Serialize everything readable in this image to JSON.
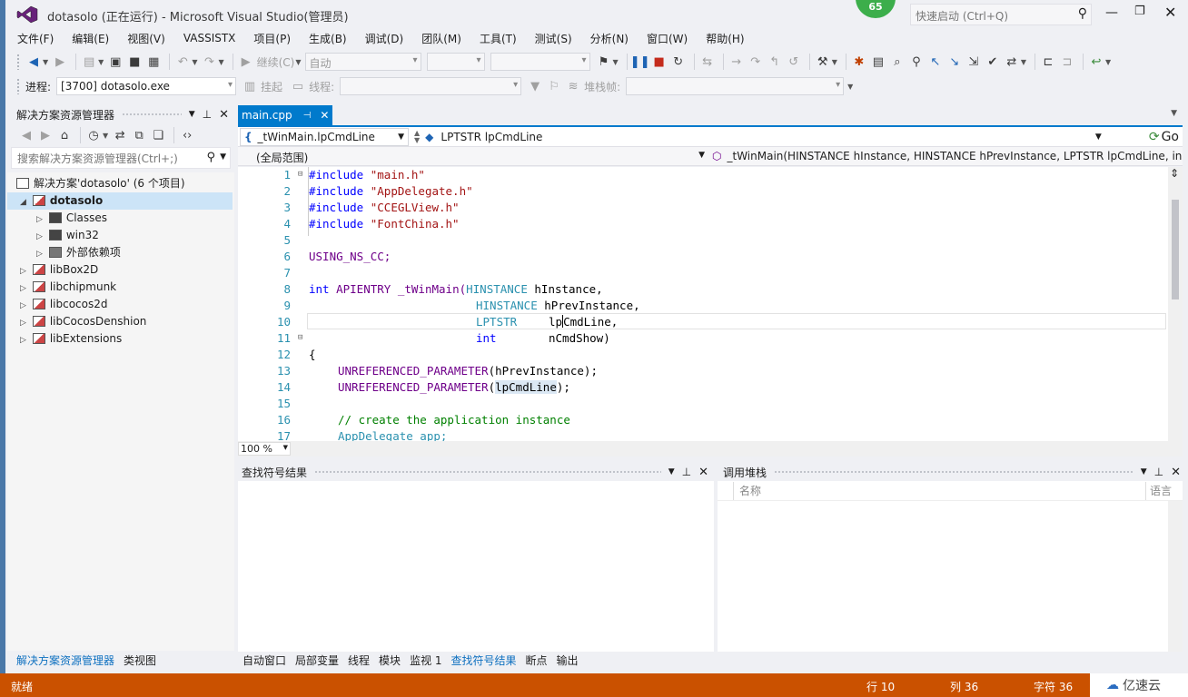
{
  "title": {
    "text": "dotasolo (正在运行) - Microsoft Visual Studio(管理员)",
    "badge": "65",
    "quick_launch": "快速启动 (Ctrl+Q)"
  },
  "menu": [
    "文件(F)",
    "编辑(E)",
    "视图(V)",
    "VASSISTX",
    "项目(P)",
    "生成(B)",
    "调试(D)",
    "团队(M)",
    "工具(T)",
    "测试(S)",
    "分析(N)",
    "窗口(W)",
    "帮助(H)"
  ],
  "toolbar": {
    "continue": "继续(C)",
    "config": "自动"
  },
  "debugbar": {
    "process_label": "进程:",
    "process_value": "[3700] dotasolo.exe",
    "suspend": "挂起",
    "thread": "线程:",
    "stackframe": "堆栈帧:"
  },
  "solution": {
    "title": "解决方案资源管理器",
    "search": "搜索解决方案资源管理器(Ctrl+;)",
    "root": "解决方案'dotasolo' (6 个项目)",
    "items": [
      "dotasolo",
      "Classes",
      "win32",
      "外部依赖项",
      "libBox2D",
      "libchipmunk",
      "libcocos2d",
      "libCocosDenshion",
      "libExtensions"
    ],
    "tab1": "解决方案资源管理器",
    "tab2": "类视图"
  },
  "editor": {
    "tab": "main.cpp",
    "nav_left": "_tWinMain.lpCmdLine",
    "nav_right": "LPTSTR lpCmdLine",
    "go": "Go",
    "scope": "(全局范围)",
    "func": "_tWinMain(HINSTANCE hInstance, HINSTANCE hPrevInstance, LPTSTR lpCmdLine, in",
    "zoom": "100 %",
    "lines": [
      "1",
      "2",
      "3",
      "4",
      "5",
      "6",
      "7",
      "8",
      "9",
      "10",
      "11",
      "12",
      "13",
      "14",
      "15",
      "16",
      "17"
    ],
    "code": {
      "inc": "#include",
      "h1": "\"main.h\"",
      "h2": "\"AppDelegate.h\"",
      "h3": "\"CCEGLView.h\"",
      "h4": "\"FontChina.h\"",
      "using": "USING_NS_CC;",
      "int": "int",
      "apientry": "APIENTRY",
      "fn": "_tWinMain(",
      "hinst": "HINSTANCE",
      "p1": "hInstance,",
      "p2": "hPrevInstance,",
      "lptstr": "LPTSTR",
      "p3a": "lp",
      "p3b": "CmdLine,",
      "p4": "nCmdShow)",
      "brace": "{",
      "unref": "UNREFERENCED_PARAMETER",
      "a1": "(hPrevInstance);",
      "a2open": "(",
      "a2": "lpCmdLine",
      "a2close": ");",
      "comment": "// create the application instance",
      "l17": "AppDelegate app;"
    }
  },
  "find": {
    "title": "查找符号结果"
  },
  "callstack": {
    "title": "调用堆栈",
    "col1": "名称",
    "col2": "语言"
  },
  "bottom_tabs": [
    "自动窗口",
    "局部变量",
    "线程",
    "模块",
    "监视 1",
    "查找符号结果",
    "断点",
    "输出"
  ],
  "status": {
    "ready": "就绪",
    "line": "行 10",
    "col": "列 36",
    "char": "字符 36",
    "brand": "亿速云"
  },
  "colors": {
    "accent": "#007acc",
    "status_bar": "#ca5100"
  }
}
